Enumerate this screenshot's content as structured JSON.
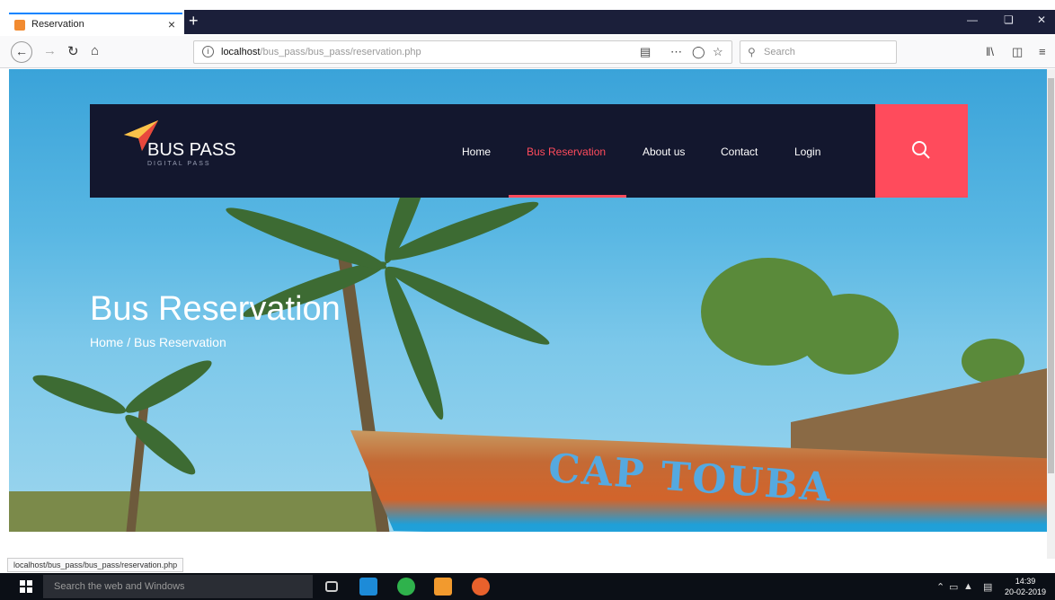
{
  "browser": {
    "tab_title": "Reservation",
    "tab_close": "×",
    "new_tab": "+",
    "url_host": "localhost",
    "url_path": "/bus_pass/bus_pass/reservation.php",
    "search_placeholder": "Search",
    "status_url": "localhost/bus_pass/bus_pass/reservation.php"
  },
  "site": {
    "logo_title": "BUS PASS",
    "logo_subtitle": "DIGITAL PASS",
    "menu": [
      {
        "label": "Home"
      },
      {
        "label": "Bus Reservation",
        "active": true
      },
      {
        "label": "About us"
      },
      {
        "label": "Contact"
      },
      {
        "label": "Login"
      }
    ],
    "hero_title": "Bus Reservation",
    "breadcrumb": "Home / Bus Reservation",
    "boat_text": "CAP TOUBA",
    "accent_color": "#ff4b5c",
    "header_color": "#13172e"
  },
  "taskbar": {
    "search_placeholder": "Search the web and Windows",
    "time": "14:39",
    "date": "20-02-2019"
  }
}
